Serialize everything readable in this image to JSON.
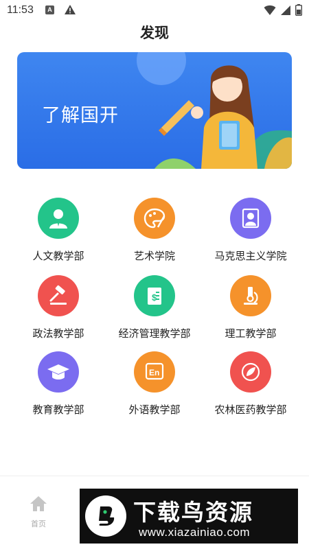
{
  "status_bar": {
    "time": "11:53",
    "notification_letter": "A"
  },
  "page": {
    "title": "发现"
  },
  "banner": {
    "text": "了解国开"
  },
  "departments": [
    {
      "label": "人文教学部",
      "color": "#23c48a",
      "icon": "person-icon"
    },
    {
      "label": "艺术学院",
      "color": "#f5922b",
      "icon": "palette-icon"
    },
    {
      "label": "马克思主义学院",
      "color": "#7b6cf0",
      "icon": "portrait-icon"
    },
    {
      "label": "政法教学部",
      "color": "#f0524f",
      "icon": "gavel-icon"
    },
    {
      "label": "经济管理教学部",
      "color": "#23c48a",
      "icon": "ledger-icon"
    },
    {
      "label": "理工教学部",
      "color": "#f5922b",
      "icon": "microscope-icon"
    },
    {
      "label": "教育教学部",
      "color": "#7b6cf0",
      "icon": "graduation-cap-icon"
    },
    {
      "label": "外语教学部",
      "color": "#f5922b",
      "icon": "language-icon",
      "icon_text": "En"
    },
    {
      "label": "农林医药教学部",
      "color": "#f0524f",
      "icon": "leaf-icon"
    }
  ],
  "bottom_nav": {
    "home_label": "首页"
  },
  "watermark": {
    "title": "下载鸟资源",
    "url": "www.xiazainiao.com"
  }
}
